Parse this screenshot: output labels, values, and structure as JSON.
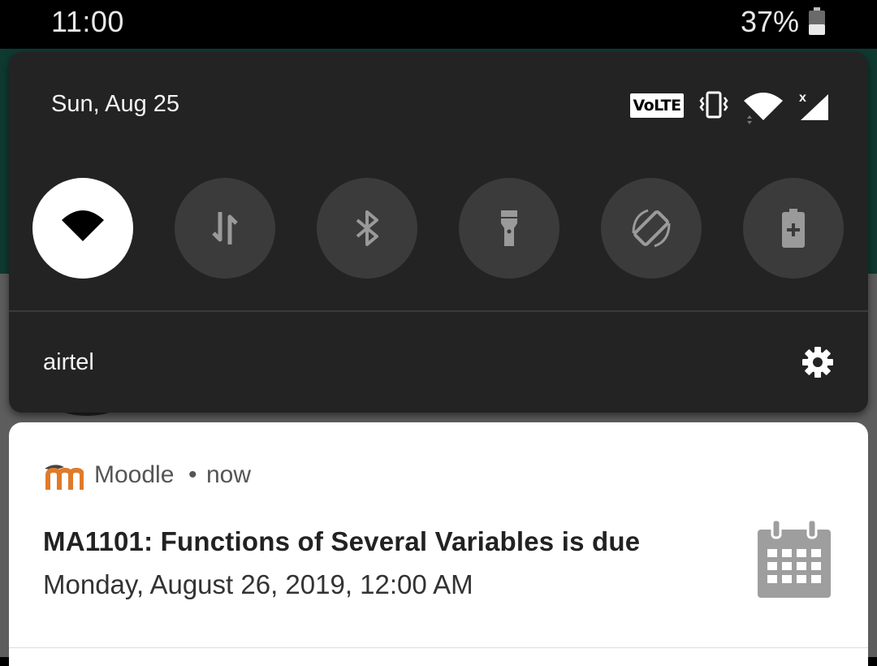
{
  "status_bar": {
    "time": "11:00",
    "battery_percent": "37%",
    "battery_level": 0.37
  },
  "quick_settings": {
    "date": "Sun, Aug 25",
    "volte_badge": "VoLTE",
    "tiles": [
      {
        "name": "wifi",
        "icon": "wifi-icon",
        "active": true
      },
      {
        "name": "mobile data",
        "icon": "data-transfer-icon",
        "active": false
      },
      {
        "name": "bluetooth",
        "icon": "bluetooth-icon",
        "active": false
      },
      {
        "name": "flashlight",
        "icon": "flashlight-icon",
        "active": false
      },
      {
        "name": "auto-rotate",
        "icon": "rotate-icon",
        "active": false
      },
      {
        "name": "battery saver",
        "icon": "battery-saver-icon",
        "active": false
      }
    ],
    "carrier": "airtel"
  },
  "notification": {
    "app_name": "Moodle",
    "separator": "•",
    "time": "now",
    "title": "MA1101: Functions of Several Variables is due",
    "text": "Monday, August 26, 2019, 12:00 AM",
    "accent_color": "#e07a2a",
    "icon": "calendar-icon"
  },
  "colors": {
    "panel_bg": "#232323",
    "tile_off": "#3b3b3b",
    "tile_on": "#ffffff"
  }
}
